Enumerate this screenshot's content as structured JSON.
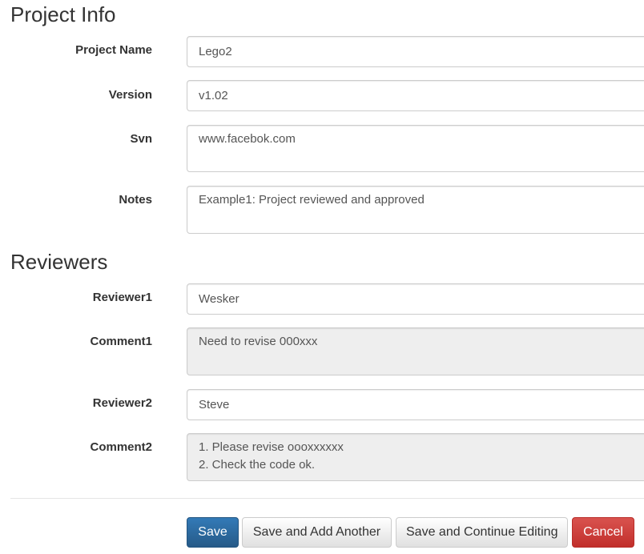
{
  "project_info": {
    "title": "Project Info",
    "project_name": {
      "label": "Project Name",
      "value": "Lego2"
    },
    "version": {
      "label": "Version",
      "value": "v1.02"
    },
    "svn": {
      "label": "Svn",
      "value": "www.facebok.com"
    },
    "notes": {
      "label": "Notes",
      "value": "Example1: Project reviewed and approved"
    }
  },
  "reviewers": {
    "title": "Reviewers",
    "reviewer1": {
      "label": "Reviewer1",
      "value": "Wesker"
    },
    "comment1": {
      "label": "Comment1",
      "value": "Need to revise 000xxx"
    },
    "reviewer2": {
      "label": "Reviewer2",
      "value": "Steve"
    },
    "comment2": {
      "label": "Comment2",
      "value": "1. Please revise oooxxxxxx\n2. Check the code ok."
    }
  },
  "actions": {
    "save": "Save",
    "save_add_another": "Save and Add Another",
    "save_continue": "Save and Continue Editing",
    "cancel": "Cancel"
  }
}
